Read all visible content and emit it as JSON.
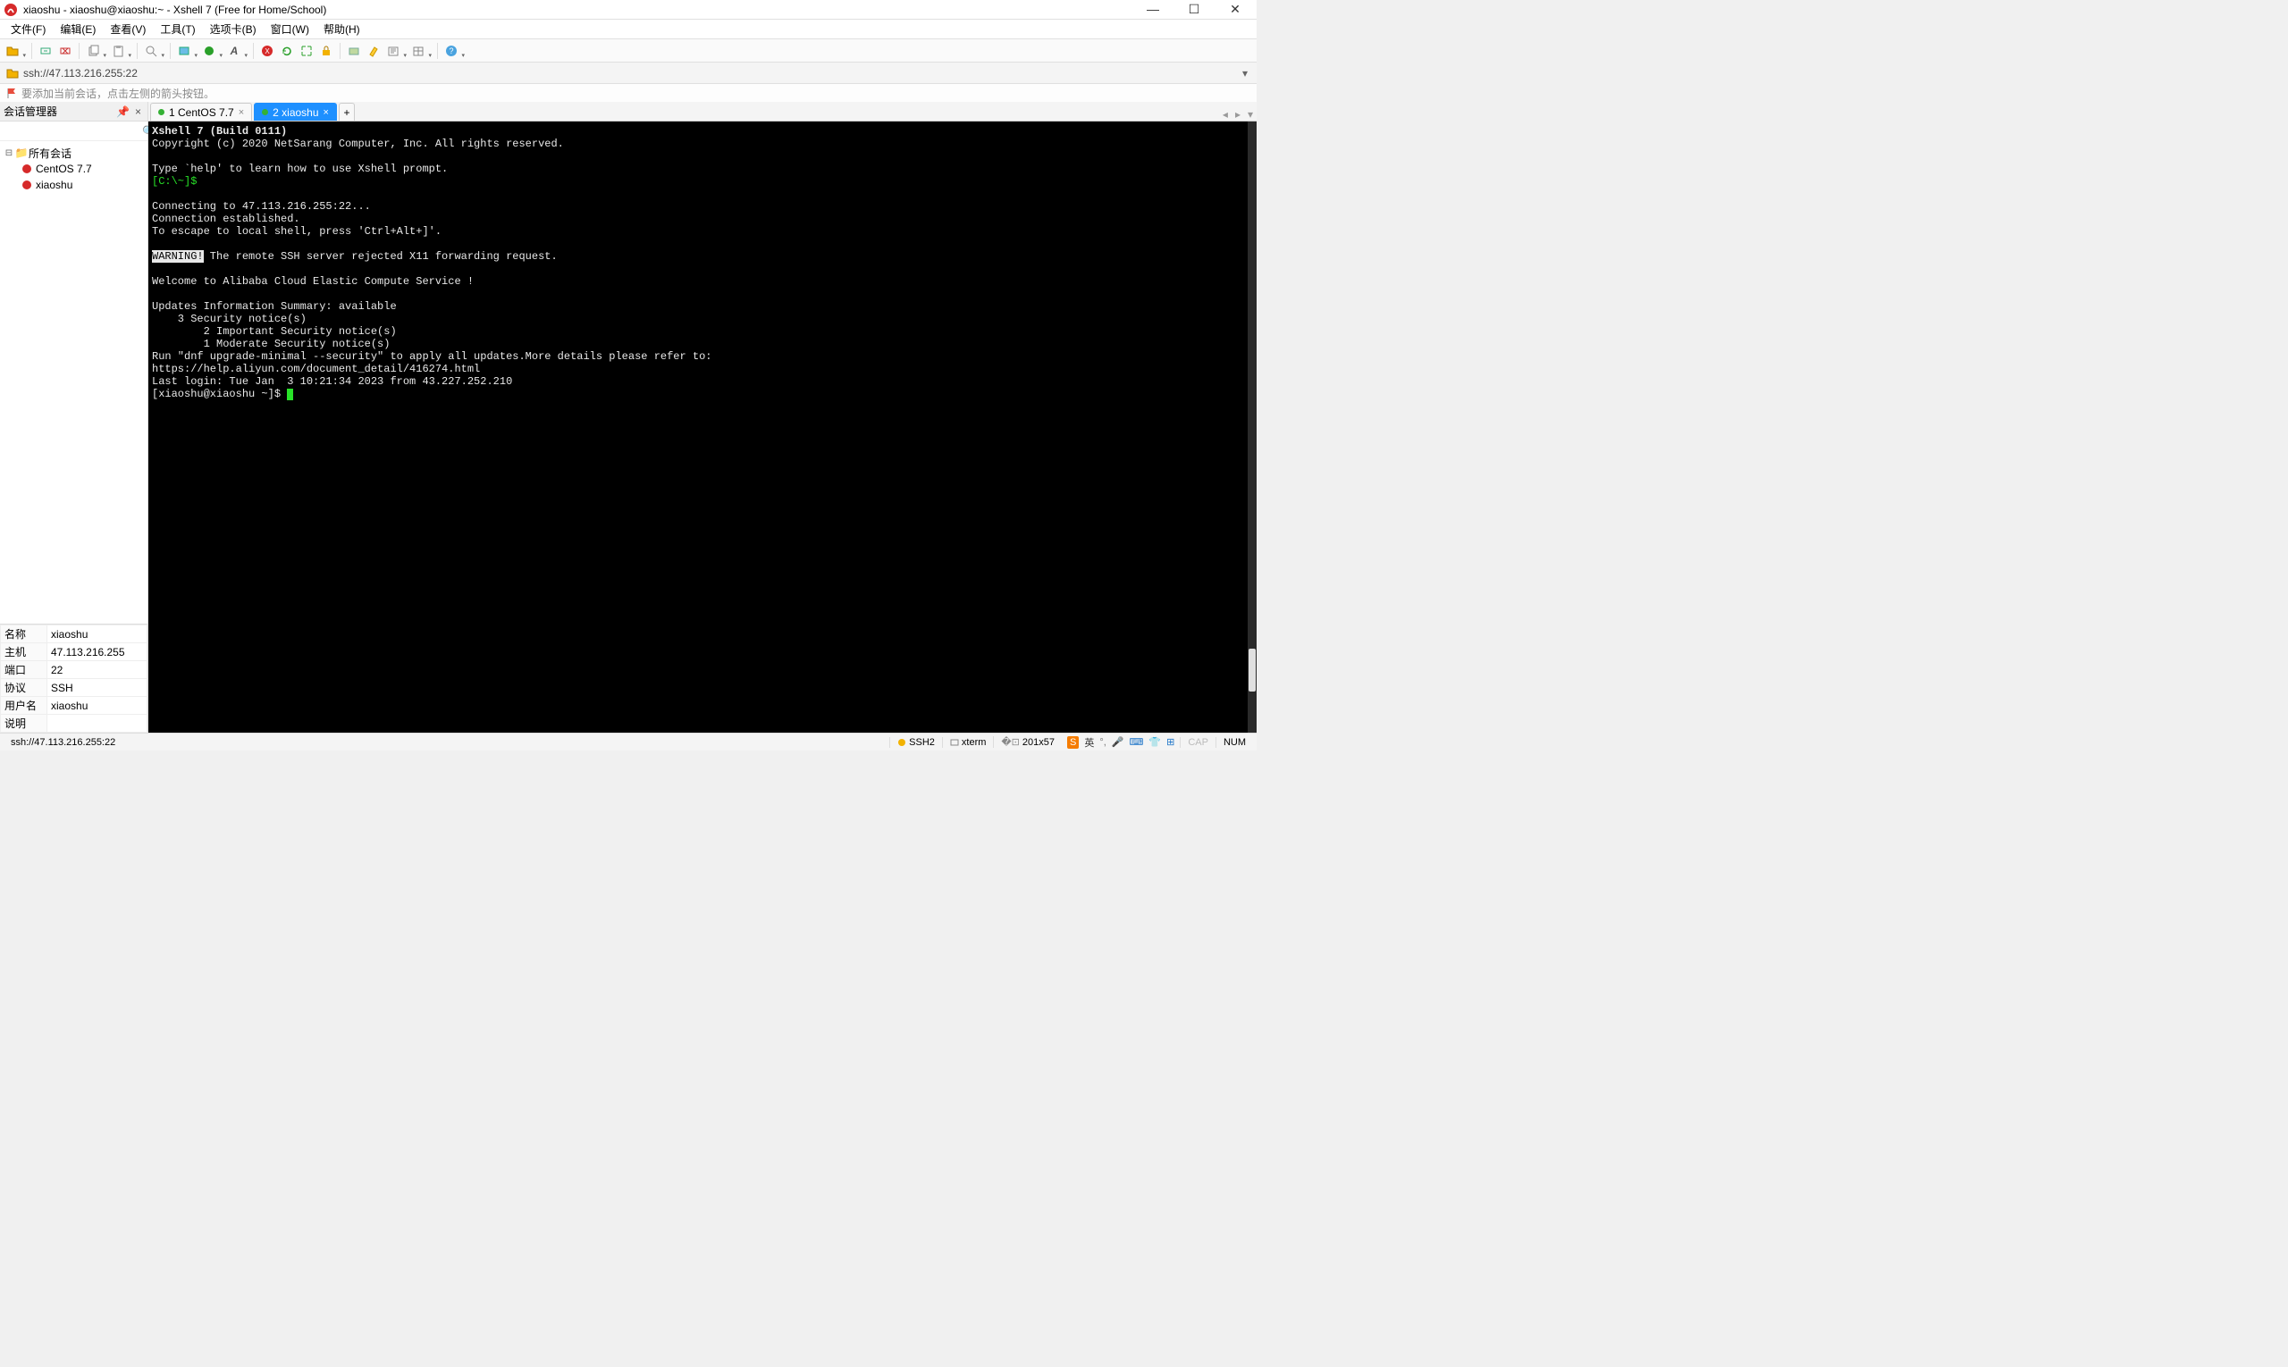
{
  "window": {
    "title": "xiaoshu - xiaoshu@xiaoshu:~ - Xshell 7 (Free for Home/School)"
  },
  "menu": {
    "items": [
      "文件(F)",
      "编辑(E)",
      "查看(V)",
      "工具(T)",
      "选项卡(B)",
      "窗口(W)",
      "帮助(H)"
    ]
  },
  "addressbar": {
    "text": "ssh://47.113.216.255:22"
  },
  "hintbar": {
    "text": "要添加当前会话，点击左侧的箭头按钮。"
  },
  "session_manager": {
    "title": "会话管理器",
    "root": "所有会话",
    "items": [
      "CentOS 7.7",
      "xiaoshu"
    ],
    "search_placeholder": ""
  },
  "properties": {
    "rows": [
      [
        "名称",
        "xiaoshu"
      ],
      [
        "主机",
        "47.113.216.255"
      ],
      [
        "端口",
        "22"
      ],
      [
        "协议",
        "SSH"
      ],
      [
        "用户名",
        "xiaoshu"
      ],
      [
        "说明",
        ""
      ]
    ]
  },
  "tabs": [
    {
      "id": "1",
      "label": "1 CentOS 7.7",
      "active": false
    },
    {
      "id": "2",
      "label": "2 xiaoshu",
      "active": true
    }
  ],
  "terminal": {
    "header_line": "Xshell 7 (Build 0111)",
    "copyright": "Copyright (c) 2020 NetSarang Computer, Inc. All rights reserved.",
    "help_line": "Type `help' to learn how to use Xshell prompt.",
    "local_prompt": "[C:\\~]$",
    "connecting": "Connecting to 47.113.216.255:22...",
    "established": "Connection established.",
    "escape": "To escape to local shell, press 'Ctrl+Alt+]'.",
    "warning_label": "WARNING!",
    "warning_text": " The remote SSH server rejected X11 forwarding request.",
    "welcome": "Welcome to Alibaba Cloud Elastic Compute Service !",
    "updates_header": "Updates Information Summary: available",
    "updates_line1": "    3 Security notice(s)",
    "updates_line2": "        2 Important Security notice(s)",
    "updates_line3": "        1 Moderate Security notice(s)",
    "run_line": "Run \"dnf upgrade-minimal --security\" to apply all updates.More details please refer to:",
    "url_line": "https://help.aliyun.com/document_detail/416274.html",
    "last_login": "Last login: Tue Jan  3 10:21:34 2023 from 43.227.252.210",
    "shell_prompt": "[xiaoshu@xiaoshu ~]$ "
  },
  "statusbar": {
    "addr": "ssh://47.113.216.255:22",
    "proto": "SSH2",
    "term": "xterm",
    "size": "201x57",
    "cap": "CAP",
    "num": "NUM",
    "ime": "英"
  }
}
